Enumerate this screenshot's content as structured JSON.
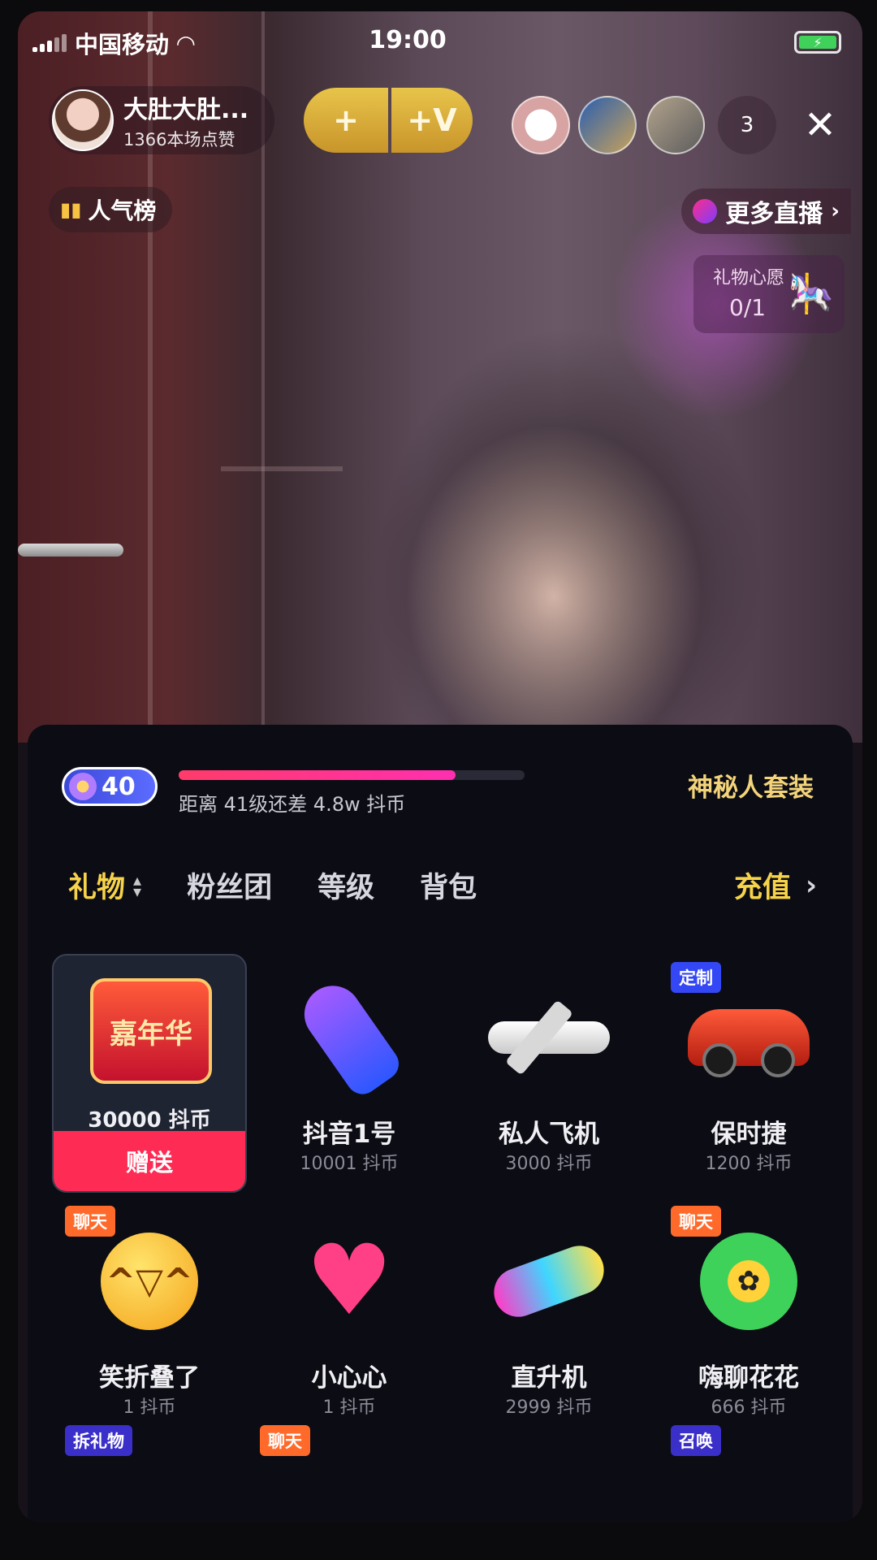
{
  "status_bar": {
    "carrier": "中国移动",
    "time": "19:00"
  },
  "host": {
    "name": "大肚大肚...",
    "likes": "1366本场点赞"
  },
  "top_buttons": {
    "follow_gold": "+",
    "vip_gold": "+V"
  },
  "viewers": {
    "count": "3"
  },
  "close_glyph": "✕",
  "rank": {
    "label": "人气榜"
  },
  "more_live": {
    "label": "更多直播"
  },
  "wish": {
    "title": "礼物心愿",
    "progress": "0/1"
  },
  "panel": {
    "level": "40",
    "level_progress_fraction": 0.8,
    "progress_text": "距离 41级还差 4.8w 抖币",
    "mystery_label": "神秘人套装",
    "tabs": [
      "礼物",
      "粉丝团",
      "等级",
      "背包"
    ],
    "recharge_label": "充值"
  },
  "gifts": [
    {
      "name": "嘉年华",
      "price": "30000 抖币",
      "tag": "",
      "send_label": "赠送",
      "icon": "carnival-icon"
    },
    {
      "name": "抖音1号",
      "price": "10001 抖币",
      "tag": "",
      "icon": "rocket-icon"
    },
    {
      "name": "私人飞机",
      "price": "3000 抖币",
      "tag": "",
      "icon": "plane-icon"
    },
    {
      "name": "保时捷",
      "price": "1200 抖币",
      "tag": "定制",
      "icon": "car-icon"
    },
    {
      "name": "笑折叠了",
      "price": "1 抖币",
      "tag": "聊天",
      "icon": "laugh-icon"
    },
    {
      "name": "小心心",
      "price": "1 抖币",
      "tag": "",
      "icon": "heart-icon"
    },
    {
      "name": "直升机",
      "price": "2999 抖币",
      "tag": "",
      "icon": "helicopter-icon"
    },
    {
      "name": "嗨聊花花",
      "price": "666 抖币",
      "tag": "聊天",
      "icon": "flower-icon"
    }
  ],
  "next_row_tags": [
    "拆礼物",
    "聊天",
    "召唤"
  ],
  "colors": {
    "accent_gold": "#f6d34a",
    "send_red": "#fe2c55",
    "tag_blue": "#3447f5",
    "tag_orange": "#ff6a2b"
  }
}
